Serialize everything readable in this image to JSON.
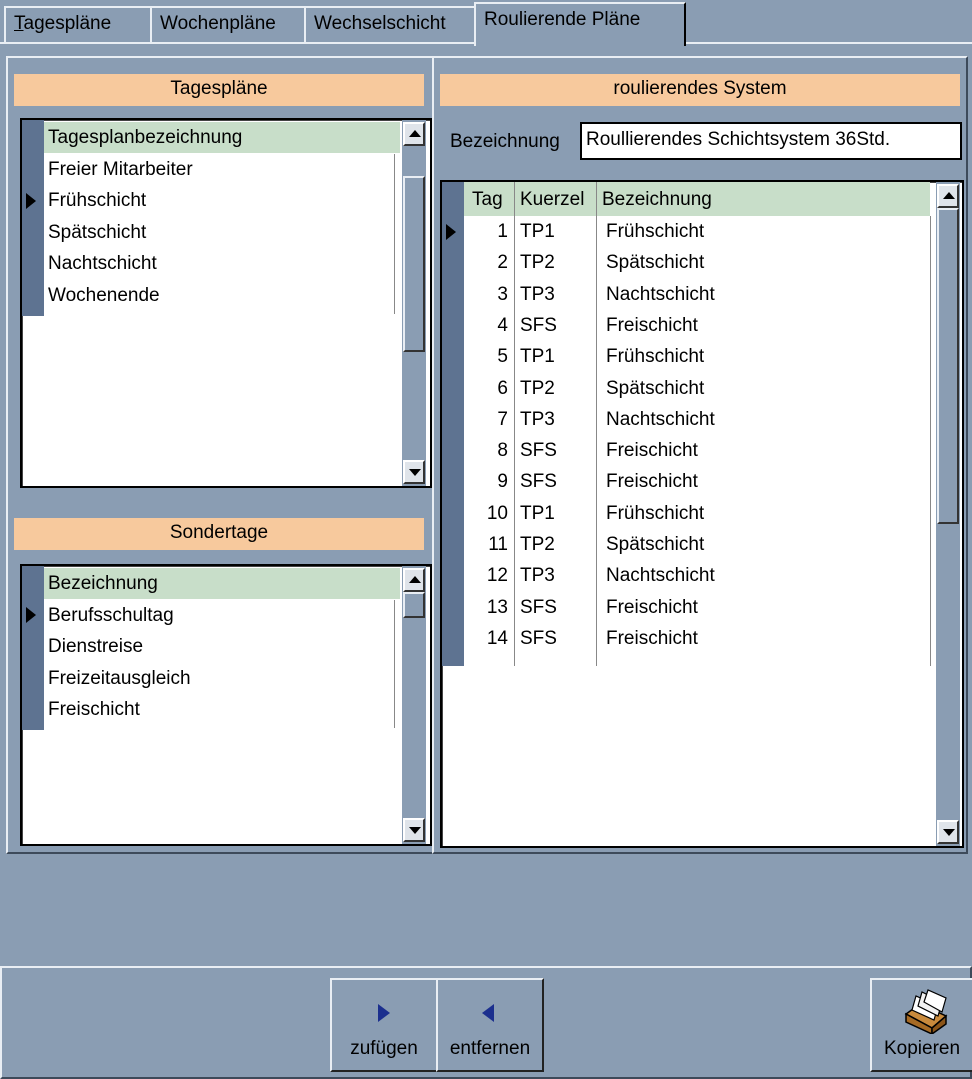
{
  "tabs": [
    {
      "label_ul": "T",
      "label_rest": "agespläne"
    },
    {
      "label": "Wochenpläne"
    },
    {
      "label": "Wechselschicht"
    },
    {
      "label": "Roulierende Pläne"
    }
  ],
  "tagesplaene": {
    "title": "Tagespläne",
    "header": "Tagesplanbezeichnung",
    "items": [
      "Freier Mitarbeiter",
      "Frühschicht",
      "Spätschicht",
      "Nachtschicht",
      "Wochenende"
    ]
  },
  "sondertage": {
    "title": "Sondertage",
    "header": "Bezeichnung",
    "items": [
      "Berufsschultag",
      "Dienstreise",
      "Freizeitausgleich",
      "Freischicht"
    ]
  },
  "system": {
    "title": "roulierendes System",
    "bezeichnung_label": "Bezeichnung",
    "bezeichnung_value": "Roullierendes Schichtsystem 36Std.",
    "columns": [
      "Tag",
      "Kuerzel",
      "Bezeichnung"
    ],
    "rows": [
      [
        "1",
        "TP1",
        "Frühschicht"
      ],
      [
        "2",
        "TP2",
        "Spätschicht"
      ],
      [
        "3",
        "TP3",
        "Nachtschicht"
      ],
      [
        "4",
        "SFS",
        "Freischicht"
      ],
      [
        "5",
        "TP1",
        "Frühschicht"
      ],
      [
        "6",
        "TP2",
        "Spätschicht"
      ],
      [
        "7",
        "TP3",
        "Nachtschicht"
      ],
      [
        "8",
        "SFS",
        "Freischicht"
      ],
      [
        "9",
        "SFS",
        "Freischicht"
      ],
      [
        "10",
        "TP1",
        "Frühschicht"
      ],
      [
        "11",
        "TP2",
        "Spätschicht"
      ],
      [
        "12",
        "TP3",
        "Nachtschicht"
      ],
      [
        "13",
        "SFS",
        "Freischicht"
      ],
      [
        "14",
        "SFS",
        "Freischicht"
      ]
    ]
  },
  "toolbar": {
    "add_label": "zufügen",
    "remove_label": "entfernen",
    "copy_label": "Kopieren"
  },
  "icons": {
    "add": "arrow-right-icon",
    "remove": "arrow-left-icon",
    "copy": "card-box-icon"
  },
  "colors": {
    "background": "#8a9db3",
    "header": "#f7c99d",
    "selected_row": "#c8dec9",
    "indicator": "#5e7391",
    "arrow": "#1b2f8e"
  }
}
